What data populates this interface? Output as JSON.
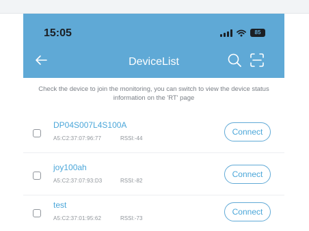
{
  "status_bar": {
    "time": "15:05",
    "battery": "85"
  },
  "nav": {
    "title": "DeviceList"
  },
  "hint": "Check the device to join the monitoring, you can switch to view the device status information on the 'RT' page",
  "devices": [
    {
      "name": "DP04S007L4S100A",
      "mac": "A5:C2:37:07:96:77",
      "rssi": "RSSI:-44",
      "action": "Connect"
    },
    {
      "name": "joy100ah",
      "mac": "A5:C2:37:07:93:D3",
      "rssi": "RSSI:-82",
      "action": "Connect"
    },
    {
      "name": "test",
      "mac": "A5:C2:37:01:95:62",
      "rssi": "RSSI:-73",
      "action": "Connect"
    }
  ],
  "colors": {
    "header": "#5fa9d6",
    "accent": "#4aa6d9"
  },
  "icons": [
    "back-arrow-icon",
    "search-icon",
    "scan-icon",
    "signal-icon",
    "wifi-icon",
    "battery-icon"
  ]
}
